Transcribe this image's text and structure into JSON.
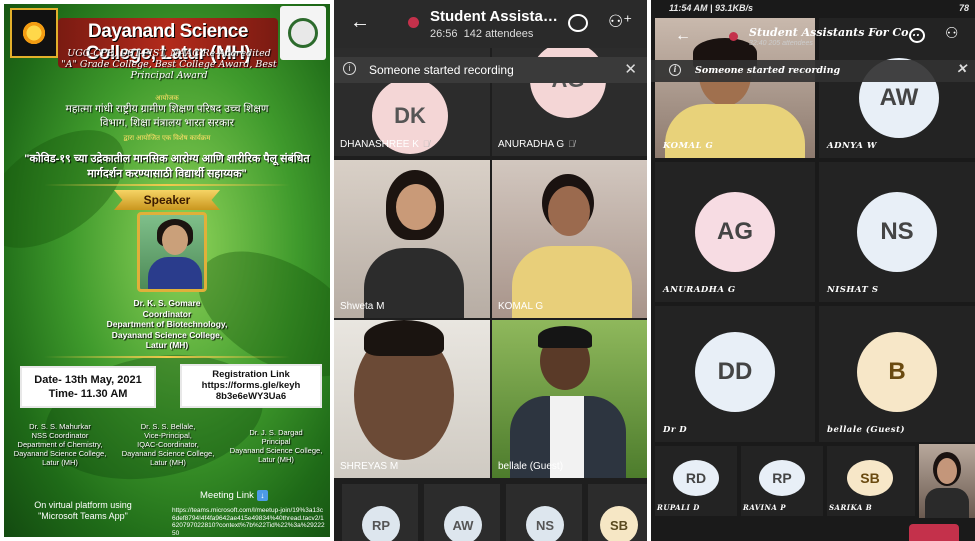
{
  "poster": {
    "title": "Dayanand Science College, Latur (MH)",
    "accreditation": "UGC-CPE, DST-FIST, NAAC Re-Accredited \"A\" Grade College, Best College Award, Best Principal Award",
    "organizer_label": "आयोजक",
    "org_hindi_1": "महात्मा गांधी राष्ट्रीय ग्रामीण शिक्षण परिषद उच्च शिक्षण",
    "org_hindi_2": "विभाग, शिक्षा मंत्रालय भारत सरकार",
    "program_label": "द्वारा आयोजित एक विशेष कार्यक्रम",
    "topic_1": "\"कोविड-१९ च्या उद्रेकातील मानसिक आरोग्य आणि शारीरिक पैलू संबंधित",
    "topic_2": "मार्गदर्शन करण्यासाठी विद्यार्थी सहाय्यक\"",
    "speaker_label": "Speaker",
    "speaker_name": "Dr. K. S. Gomare",
    "speaker_role": "Coordinator",
    "speaker_dept": "Department of Biotechnology,",
    "speaker_college": "Dayanand Science College,",
    "speaker_city": "Latur (MH)",
    "date": "Date- 13th May, 2021",
    "time": "Time- 11.30 AM",
    "reg_label": "Registration Link",
    "reg_link": "https://forms.gle/keyh",
    "reg_link2": "8b3e6eWY3Ua6",
    "sig1": [
      "Dr. S. S. Mahurkar",
      "NSS Coordinator",
      "Department of Chemistry,",
      "Dayanand Science College,",
      "Latur (MH)"
    ],
    "sig2": [
      "Dr. S. S. Bellale,",
      "Vice-Principal,",
      "IQAC-Coordinator,",
      "Dayanand Science College,",
      "Latur (MH)"
    ],
    "sig3": [
      "Dr. J. S. Dargad",
      "Principal",
      "Dayanand Science College,",
      "Latur (MH)"
    ],
    "virtual_1": "On virtual platform using",
    "virtual_2": "\"Microsoft Teams App\"",
    "meeting_label": "Meeting Link",
    "meeting_url": "https://teams.microsoft.com/l/meetup-join/19%3a13c6def8794!4f4fa9642ae415e49834%40thread.tacv2/1620797022810?context%7b%22Tid%22%3a%2922250"
  },
  "call_a": {
    "title": "Student Assistant...",
    "duration": "26:56",
    "attendees": "142 attendees",
    "banner": "Someone started recording",
    "top_avatars": [
      {
        "initials": "DK",
        "color": "#f4d6d6",
        "name": "DHANASHREE K"
      },
      {
        "initials": "AG",
        "color": "#f4d6d6",
        "name": "ANURADHA G"
      }
    ],
    "video_tiles": [
      {
        "name": "Shweta M"
      },
      {
        "name": "KOMAL G"
      },
      {
        "name": "SHREYAS M"
      },
      {
        "name": "bellale (Guest)"
      }
    ],
    "bottom_avatars": [
      {
        "initials": "RP",
        "color": "#dde6ee"
      },
      {
        "initials": "AW",
        "color": "#dde6ee"
      },
      {
        "initials": "NS",
        "color": "#dde6ee"
      },
      {
        "initials": "SB",
        "color": "#f6e7c5"
      }
    ]
  },
  "call_b": {
    "status_left": "11:54 AM | 93.1KB/s",
    "status_right": "78",
    "title": "Student Assistants For Co...",
    "subtitle": "32:40  205 attendees",
    "banner": "Someone started recording",
    "tiles": [
      {
        "initials": "",
        "color": "",
        "name": "KOMAL G"
      },
      {
        "initials": "AW",
        "color": "#e8eff7",
        "name": "ADNYA W"
      },
      {
        "initials": "AG",
        "color": "#f7dce3",
        "name": "ANURADHA G"
      },
      {
        "initials": "NS",
        "color": "#e8eff7",
        "name": "NISHAT S"
      },
      {
        "initials": "DD",
        "color": "#e8eff7",
        "name": "Dr D"
      },
      {
        "initials": "B",
        "color": "#f7e7c8",
        "name": "bellale (Guest)"
      }
    ],
    "bottom": [
      {
        "initials": "RD",
        "color": "#e8eff7",
        "name": "RUPALI D"
      },
      {
        "initials": "RP",
        "color": "#e8eff7",
        "name": "RAVINA P"
      },
      {
        "initials": "SB",
        "color": "#f7e7c8",
        "name": "SARIKA B"
      }
    ]
  }
}
